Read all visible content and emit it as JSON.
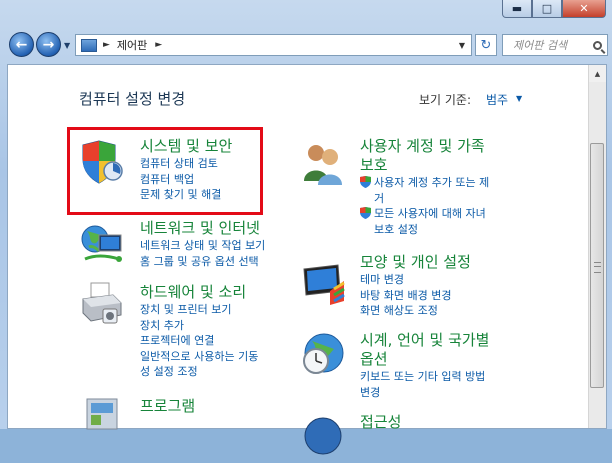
{
  "window": {
    "caption_buttons": [
      "minimize",
      "maximize",
      "close"
    ]
  },
  "nav": {
    "address_segments": [
      "제어판"
    ],
    "search_placeholder": "제어판 검색"
  },
  "header": {
    "title": "컴퓨터 설정 변경",
    "view_by_label": "보기 기준:",
    "view_by_value": "범주"
  },
  "categories_left": [
    {
      "title": "시스템 및 보안",
      "links": [
        "컴퓨터 상태 검토",
        "컴퓨터 백업",
        "문제 찾기 및 해결"
      ],
      "icon": "shield-icon"
    },
    {
      "title": "네트워크 및 인터넷",
      "links": [
        "네트워크 상태 및 작업 보기",
        "홈 그룹 및 공유 옵션 선택"
      ],
      "icon": "network-globe-icon"
    },
    {
      "title": "하드웨어 및 소리",
      "links": [
        "장치 및 프린터 보기",
        "장치 추가",
        "프로젝터에 연결",
        "일반적으로 사용하는 기동",
        "성 설정 조정"
      ],
      "icon": "printer-icon"
    },
    {
      "title": "프로그램",
      "links": [],
      "icon": "programs-icon"
    }
  ],
  "categories_right": [
    {
      "title_lines": [
        "사용자 계정 및 가족",
        "보호"
      ],
      "links": [
        "사용자 계정 추가 또는 제",
        "거",
        "모든 사용자에 대해 자녀",
        "보호 설정"
      ],
      "icon": "users-icon"
    },
    {
      "title_lines": [
        "모양 및 개인 설정"
      ],
      "links": [
        "테마 변경",
        "바탕 화면 배경 변경",
        "화면 해상도 조정"
      ],
      "icon": "monitor-display-icon"
    },
    {
      "title_lines": [
        "시계, 언어 및 국가별",
        "옵션"
      ],
      "links": [
        "키보드 또는 기타 입력 방법",
        "변경"
      ],
      "icon": "clock-globe-icon"
    },
    {
      "title_lines": [
        "접근성"
      ],
      "links": [],
      "icon": "ease-of-access-icon"
    }
  ],
  "colors": {
    "category_title": "#17843a",
    "link": "#0b5aa7",
    "highlight_box": "#e30b17"
  }
}
